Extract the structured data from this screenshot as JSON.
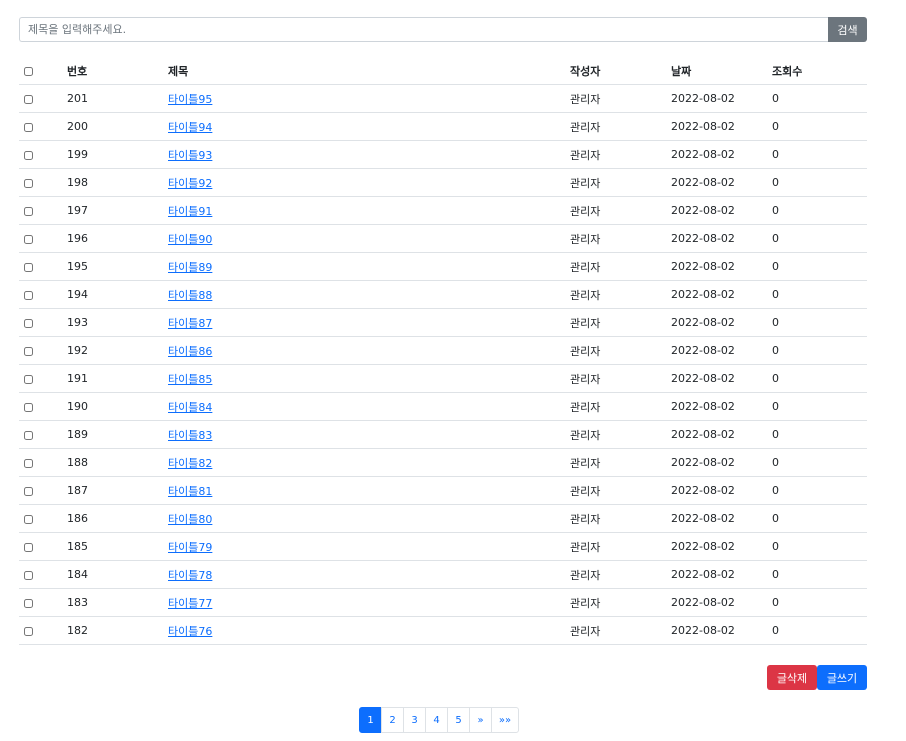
{
  "search": {
    "placeholder": "제목을 입력해주세요.",
    "button_label": "검색"
  },
  "table": {
    "headers": {
      "number": "번호",
      "title": "제목",
      "author": "작성자",
      "date": "날짜",
      "views": "조회수"
    },
    "rows": [
      {
        "number": "201",
        "title": "타이틀95",
        "author": "관리자",
        "date": "2022-08-02",
        "views": "0"
      },
      {
        "number": "200",
        "title": "타이틀94",
        "author": "관리자",
        "date": "2022-08-02",
        "views": "0"
      },
      {
        "number": "199",
        "title": "타이틀93",
        "author": "관리자",
        "date": "2022-08-02",
        "views": "0"
      },
      {
        "number": "198",
        "title": "타이틀92",
        "author": "관리자",
        "date": "2022-08-02",
        "views": "0"
      },
      {
        "number": "197",
        "title": "타이틀91",
        "author": "관리자",
        "date": "2022-08-02",
        "views": "0"
      },
      {
        "number": "196",
        "title": "타이틀90",
        "author": "관리자",
        "date": "2022-08-02",
        "views": "0"
      },
      {
        "number": "195",
        "title": "타이틀89",
        "author": "관리자",
        "date": "2022-08-02",
        "views": "0"
      },
      {
        "number": "194",
        "title": "타이틀88",
        "author": "관리자",
        "date": "2022-08-02",
        "views": "0"
      },
      {
        "number": "193",
        "title": "타이틀87",
        "author": "관리자",
        "date": "2022-08-02",
        "views": "0"
      },
      {
        "number": "192",
        "title": "타이틀86",
        "author": "관리자",
        "date": "2022-08-02",
        "views": "0"
      },
      {
        "number": "191",
        "title": "타이틀85",
        "author": "관리자",
        "date": "2022-08-02",
        "views": "0"
      },
      {
        "number": "190",
        "title": "타이틀84",
        "author": "관리자",
        "date": "2022-08-02",
        "views": "0"
      },
      {
        "number": "189",
        "title": "타이틀83",
        "author": "관리자",
        "date": "2022-08-02",
        "views": "0"
      },
      {
        "number": "188",
        "title": "타이틀82",
        "author": "관리자",
        "date": "2022-08-02",
        "views": "0"
      },
      {
        "number": "187",
        "title": "타이틀81",
        "author": "관리자",
        "date": "2022-08-02",
        "views": "0"
      },
      {
        "number": "186",
        "title": "타이틀80",
        "author": "관리자",
        "date": "2022-08-02",
        "views": "0"
      },
      {
        "number": "185",
        "title": "타이틀79",
        "author": "관리자",
        "date": "2022-08-02",
        "views": "0"
      },
      {
        "number": "184",
        "title": "타이틀78",
        "author": "관리자",
        "date": "2022-08-02",
        "views": "0"
      },
      {
        "number": "183",
        "title": "타이틀77",
        "author": "관리자",
        "date": "2022-08-02",
        "views": "0"
      },
      {
        "number": "182",
        "title": "타이틀76",
        "author": "관리자",
        "date": "2022-08-02",
        "views": "0"
      }
    ]
  },
  "actions": {
    "delete_label": "글삭제",
    "write_label": "글쓰기"
  },
  "pagination": {
    "pages": [
      "1",
      "2",
      "3",
      "4",
      "5"
    ],
    "current": "1",
    "next_label": "»",
    "last_label": "»»"
  },
  "colors": {
    "primary": "#0d6efd",
    "danger": "#dc3545",
    "secondary": "#6c757d"
  }
}
